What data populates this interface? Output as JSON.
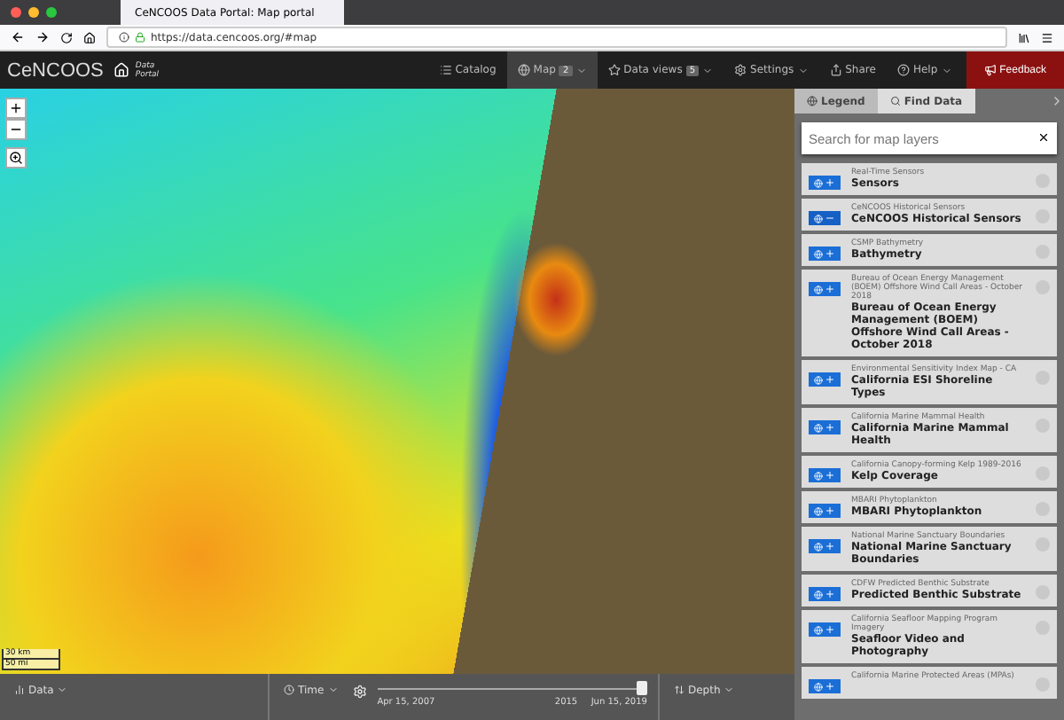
{
  "browser": {
    "tab_title": "CeNCOOS Data Portal: Map portal",
    "url": "https://data.cencoos.org/#map"
  },
  "navbar": {
    "logo": "CeNCOOS",
    "subtitle": "Data Portal",
    "items": [
      {
        "label": "Catalog",
        "selected": false,
        "dropdown": false
      },
      {
        "label": "Map",
        "badge": "2",
        "selected": true,
        "dropdown": true
      },
      {
        "label": "Data views",
        "badge": "5",
        "selected": false,
        "dropdown": true
      },
      {
        "label": "Settings",
        "selected": false,
        "dropdown": true
      },
      {
        "label": "Share",
        "selected": false,
        "dropdown": false
      },
      {
        "label": "Help",
        "selected": false,
        "dropdown": true
      }
    ],
    "feedback": "Feedback"
  },
  "map": {
    "scale": [
      "30 km",
      "50 mi"
    ]
  },
  "panel": {
    "tabs": [
      {
        "label": "Legend",
        "selected": false
      },
      {
        "label": "Find Data",
        "selected": true
      }
    ],
    "search": {
      "placeholder": "Search for map layers"
    },
    "layers": [
      {
        "category": "Real-Time Sensors",
        "title": "Sensors",
        "active": false
      },
      {
        "category": "CeNCOOS Historical Sensors",
        "title": "CeNCOOS Historical Sensors",
        "active": true
      },
      {
        "category": "CSMP Bathymetry",
        "title": "Bathymetry",
        "active": false
      },
      {
        "category": "Bureau of Ocean Energy Management (BOEM) Offshore Wind Call Areas - October 2018",
        "title": "Bureau of Ocean Energy Management (BOEM) Offshore Wind Call Areas - October 2018",
        "active": false
      },
      {
        "category": "Environmental Sensitivity Index Map - CA",
        "title": "California ESI Shoreline Types",
        "active": false
      },
      {
        "category": "California Marine Mammal Health",
        "title": "California Marine Mammal Health",
        "active": false
      },
      {
        "category": "California Canopy-forming Kelp 1989-2016",
        "title": "Kelp Coverage",
        "active": false
      },
      {
        "category": "MBARI Phytoplankton",
        "title": "MBARI Phytoplankton",
        "active": false
      },
      {
        "category": "National Marine Sanctuary Boundaries",
        "title": "National Marine Sanctuary Boundaries",
        "active": false
      },
      {
        "category": "CDFW Predicted Benthic Substrate",
        "title": "Predicted Benthic Substrate",
        "active": false
      },
      {
        "category": "California Seafloor Mapping Program Imagery",
        "title": "Seafloor Video and Photography",
        "active": false
      },
      {
        "category": "California Marine Protected Areas (MPAs)",
        "active": false
      }
    ]
  },
  "bottom": {
    "data": "Data",
    "time": "Time",
    "depth": "Depth",
    "timeline": {
      "start": "Apr 15, 2007",
      "mid": "2015",
      "end": "Jun 15, 2019",
      "level": 1
    }
  }
}
